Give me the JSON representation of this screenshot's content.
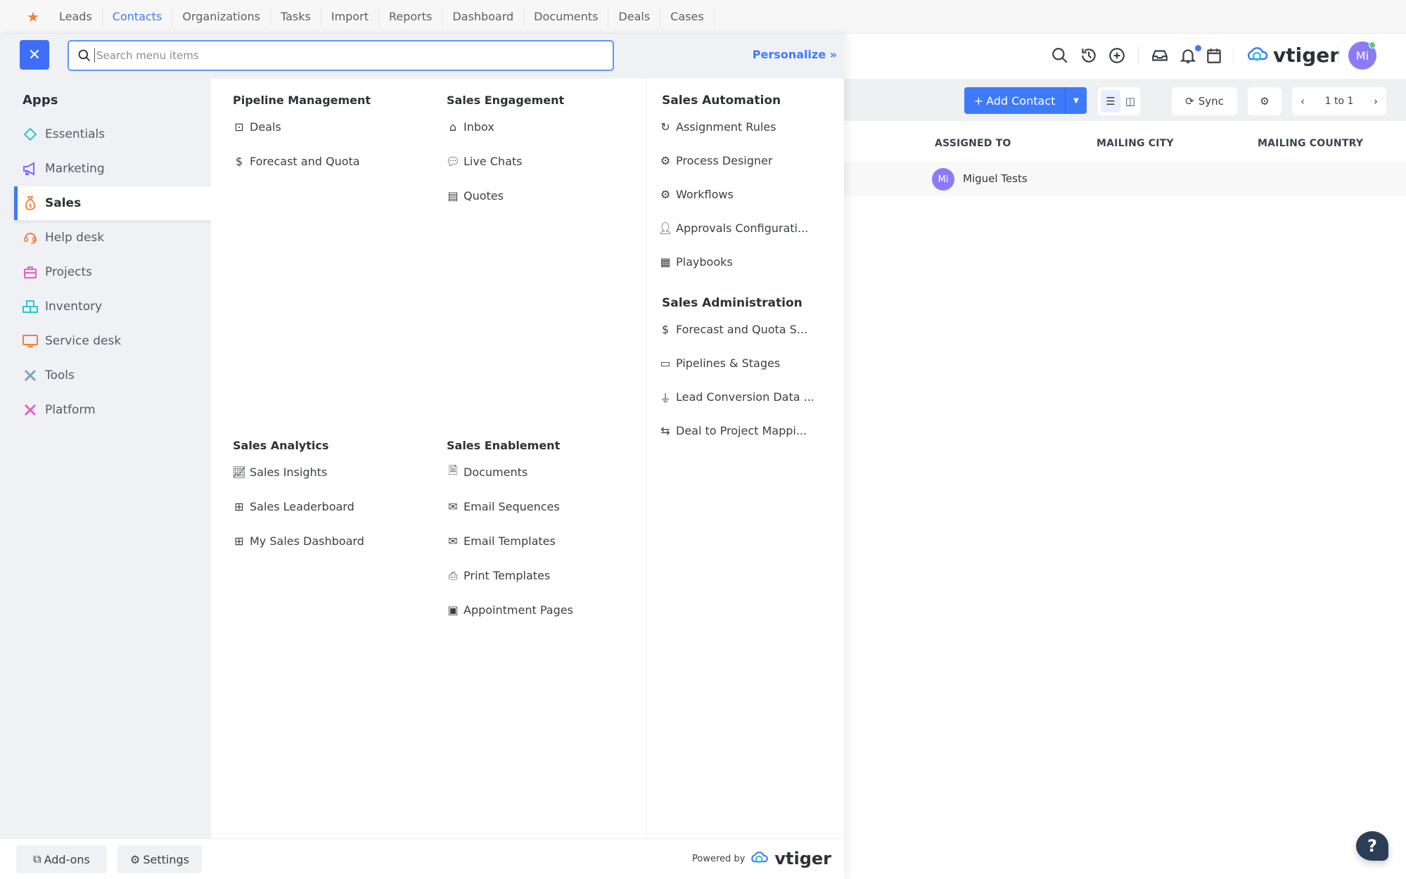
{
  "topnav": {
    "favorite_icon": "star-icon",
    "tabs": [
      {
        "label": "Leads",
        "active": false
      },
      {
        "label": "Contacts",
        "active": true
      },
      {
        "label": "Organizations",
        "active": false
      },
      {
        "label": "Tasks",
        "active": false
      },
      {
        "label": "Import",
        "active": false
      },
      {
        "label": "Reports",
        "active": false
      },
      {
        "label": "Dashboard",
        "active": false
      },
      {
        "label": "Documents",
        "active": false
      },
      {
        "label": "Deals",
        "active": false
      },
      {
        "label": "Cases",
        "active": false
      }
    ]
  },
  "overlay": {
    "close_icon": "close-icon",
    "search": {
      "placeholder": "Search menu items",
      "value": ""
    },
    "personalize_label": "Personalize",
    "personalize_icon": "double-chevron-right-icon"
  },
  "sidebar": {
    "title": "Apps",
    "items": [
      {
        "label": "Essentials",
        "icon": "diamond-icon",
        "color": "#2ec4d6",
        "active": false
      },
      {
        "label": "Marketing",
        "icon": "megaphone-icon",
        "color": "#7b6cf6",
        "active": false
      },
      {
        "label": "Sales",
        "icon": "money-bag-icon",
        "color": "#f47f3a",
        "active": true
      },
      {
        "label": "Help desk",
        "icon": "headset-icon",
        "color": "#f47f3a",
        "active": false
      },
      {
        "label": "Projects",
        "icon": "briefcase-icon",
        "color": "#e85fc8",
        "active": false
      },
      {
        "label": "Inventory",
        "icon": "boxes-icon",
        "color": "#2ec4d6",
        "active": false
      },
      {
        "label": "Service desk",
        "icon": "monitor-icon",
        "color": "#f47f3a",
        "active": false
      },
      {
        "label": "Tools",
        "icon": "tools-icon",
        "color": "#7aa3c8",
        "active": false
      },
      {
        "label": "Platform",
        "icon": "platform-tools-icon",
        "color": "#e85fc8",
        "active": false
      }
    ]
  },
  "menu": {
    "pipeline_management": {
      "title": "Pipeline Management",
      "items": [
        {
          "label": "Deals",
          "icon": "deal-bag-icon"
        },
        {
          "label": "Forecast and Quota",
          "icon": "forecast-icon"
        }
      ]
    },
    "sales_engagement": {
      "title": "Sales Engagement",
      "items": [
        {
          "label": "Inbox",
          "icon": "inbox-icon"
        },
        {
          "label": "Live Chats",
          "icon": "chat-icon"
        },
        {
          "label": "Quotes",
          "icon": "quote-document-icon"
        }
      ]
    },
    "sales_automation": {
      "title": "Sales Automation",
      "items": [
        {
          "label": "Assignment Rules",
          "icon": "refresh-icon"
        },
        {
          "label": "Process Designer",
          "icon": "gear-icon"
        },
        {
          "label": "Workflows",
          "icon": "gears-icon"
        },
        {
          "label": "Approvals Configurati...",
          "icon": "user-check-icon"
        },
        {
          "label": "Playbooks",
          "icon": "playbook-icon"
        }
      ]
    },
    "sales_administration": {
      "title": "Sales Administration",
      "items": [
        {
          "label": "Forecast and Quota S...",
          "icon": "forecast-icon"
        },
        {
          "label": "Pipelines & Stages",
          "icon": "pipeline-icon"
        },
        {
          "label": "Lead Conversion Data ...",
          "icon": "plug-icon"
        },
        {
          "label": "Deal to Project Mappi...",
          "icon": "mapping-icon"
        }
      ]
    },
    "sales_analytics": {
      "title": "Sales Analytics",
      "items": [
        {
          "label": "Sales Insights",
          "icon": "line-chart-icon"
        },
        {
          "label": "Sales Leaderboard",
          "icon": "grid-icon"
        },
        {
          "label": "My Sales Dashboard",
          "icon": "grid-icon"
        }
      ]
    },
    "sales_enablement": {
      "title": "Sales Enablement",
      "items": [
        {
          "label": "Documents",
          "icon": "document-icon"
        },
        {
          "label": "Email Sequences",
          "icon": "email-sequence-icon"
        },
        {
          "label": "Email Templates",
          "icon": "email-open-icon"
        },
        {
          "label": "Print Templates",
          "icon": "printer-icon"
        },
        {
          "label": "Appointment Pages",
          "icon": "calendar-icon"
        }
      ]
    }
  },
  "footer": {
    "addons_label": "Add-ons",
    "addons_icon": "puzzle-icon",
    "settings_label": "Settings",
    "settings_icon": "gear-icon",
    "powered_by": "Powered by",
    "brand": "vtiger"
  },
  "header": {
    "icons": [
      "search-icon",
      "history-icon",
      "add-circle-icon",
      "inbox-icon",
      "bell-icon",
      "calendar-icon"
    ],
    "notification_dot_color": "#3e7bfa",
    "brand": "vtiger",
    "avatar_initials": "Mi",
    "avatar_color": "#8b7cf6",
    "status_color": "#5fc58a"
  },
  "toolbar": {
    "add_label": "Add Contact",
    "sync_label": "Sync",
    "pagination": "1 to 1"
  },
  "table": {
    "columns": [
      "ASSIGNED TO",
      "MAILING CITY",
      "MAILING COUNTRY"
    ],
    "rows": [
      {
        "assigned_initials": "Mi",
        "assigned_to": "Miguel Tests",
        "mailing_city": "",
        "mailing_country": ""
      }
    ]
  },
  "colors": {
    "accent": "#3e7bfa",
    "close_button": "#3e6ef7",
    "help_button": "#2b3e55"
  }
}
